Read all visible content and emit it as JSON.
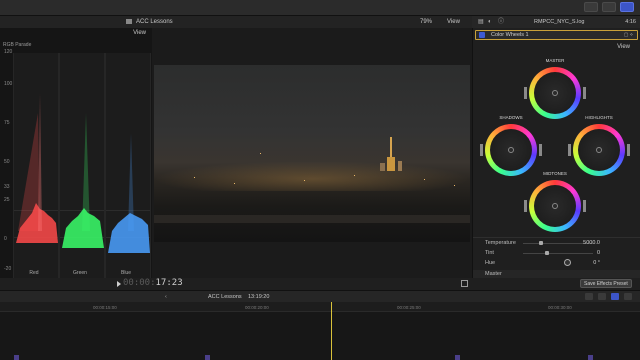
{
  "header": {
    "library_title": "ACC Lessons",
    "zoom": "79%",
    "view_label": "View",
    "clip_name": "RMPCC_NYC_S.log",
    "timecode": "4:16"
  },
  "scopes": {
    "view_label": "View",
    "mode": "RGB Parade",
    "scale": [
      "120",
      "100",
      "75",
      "50",
      "33",
      "25",
      "0",
      "-20"
    ],
    "channels": [
      {
        "name": "Red",
        "color": "#ff4a4a"
      },
      {
        "name": "Green",
        "color": "#3aff6a"
      },
      {
        "name": "Blue",
        "color": "#4aa0ff"
      }
    ]
  },
  "inspector": {
    "effect_name": "Color Wheels 1",
    "view_label": "View",
    "wheels": [
      {
        "label": "MASTER"
      },
      {
        "label": "SHADOWS"
      },
      {
        "label": "HIGHLIGHTS"
      },
      {
        "label": "MIDTONES"
      }
    ],
    "properties": [
      {
        "label": "Temperature",
        "value": "5000.0"
      },
      {
        "label": "Tint",
        "value": "0"
      },
      {
        "label": "Hue",
        "value": "0 °"
      }
    ],
    "section_label": "Master",
    "save_preset": "Save Effects Preset"
  },
  "transport": {
    "timecode_dim": "00:00:",
    "timecode": "17:23"
  },
  "timeline": {
    "library": "ACC Lessons",
    "duration": "13:19:20",
    "ruler": [
      "00:00:15:00",
      "00:00:20:00",
      "00:00:25:00",
      "00:00:30:00",
      "00:00:35:00"
    ]
  },
  "colors": {
    "accent": "#3c55c8",
    "playhead": "#d9c23a",
    "effect_border": "#c9a13a"
  }
}
